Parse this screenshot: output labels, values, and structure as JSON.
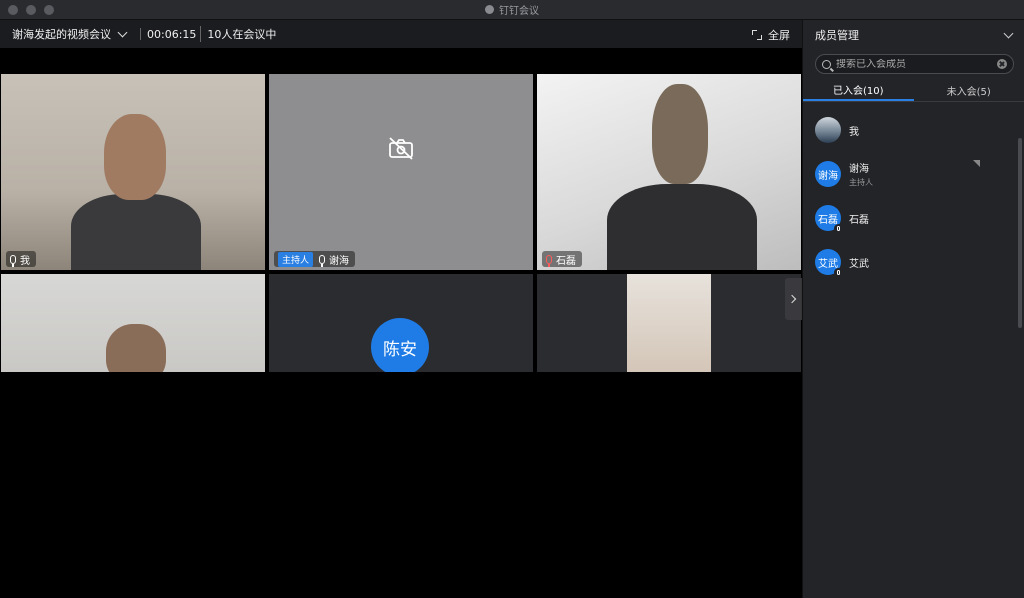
{
  "window": {
    "title": "钉钉会议"
  },
  "meeting": {
    "title": "谢海发起的视频会议",
    "timer": "00:06:15",
    "participants_in_meeting": "10人在会议中",
    "fullscreen_label": "全屏"
  },
  "tiles": [
    {
      "name": "我",
      "mic": "on"
    },
    {
      "name": "谢海",
      "host_tag": "主持人",
      "mic": "on",
      "camera": "off"
    },
    {
      "name": "石磊",
      "mic": "muted"
    },
    {
      "name": ""
    },
    {
      "name": "陈安",
      "avatar_text": "陈安"
    },
    {
      "name": ""
    }
  ],
  "panel": {
    "title": "成员管理",
    "search_placeholder": "搜索已入会成员",
    "tabs": [
      {
        "label": "已入会(10)",
        "active": true
      },
      {
        "label": "未入会(5)",
        "active": false
      }
    ],
    "members": [
      {
        "name": "我",
        "avatar": "photo"
      },
      {
        "name": "谢海",
        "role": "主持人",
        "avatar_text": "谢海"
      },
      {
        "name": "石磊",
        "avatar_text": "石磊"
      },
      {
        "name": "艾武",
        "avatar_text": "艾武"
      }
    ]
  },
  "colors": {
    "accent": "#2a7fe3",
    "avatar_blue": "#1f7ce6",
    "muted_red": "#ff5a5a"
  }
}
